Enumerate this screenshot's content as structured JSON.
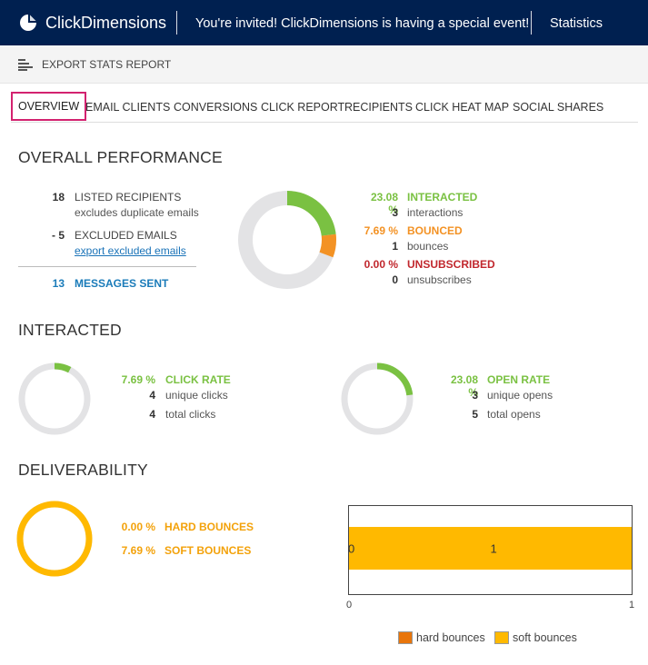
{
  "header": {
    "app_name": "ClickDimensions",
    "invite_text": "You're invited! ClickDimensions is having a special event!",
    "stats_link": "Statistics",
    "bg_color": "#002050"
  },
  "command_bar": {
    "export_label": "EXPORT STATS REPORT",
    "icon": "report-icon"
  },
  "tabs": [
    {
      "label": "OVERVIEW",
      "active": true
    },
    {
      "label": "EMAIL CLIENTS"
    },
    {
      "label": "CONVERSIONS"
    },
    {
      "label": "CLICK REPORT"
    },
    {
      "label": "RECIPIENTS"
    },
    {
      "label": "CLICK HEAT MAP"
    },
    {
      "label": "SOCIAL SHARES"
    }
  ],
  "overall": {
    "title": "OVERALL PERFORMANCE",
    "listed_num": "18",
    "listed_label": "LISTED RECIPIENTS",
    "listed_sub": "excludes duplicate emails",
    "excluded_num": "- 5",
    "excluded_label": "EXCLUDED EMAILS",
    "excluded_link": "export excluded emails",
    "sent_num": "13",
    "sent_label": "MESSAGES SENT",
    "donut": {
      "interacted_fraction": 0.2308,
      "bounced_fraction": 0.0769,
      "unsubscribed_fraction": 0.0
    },
    "interacted_pct": "23.08 %",
    "interacted_label": "INTERACTED",
    "interactions_num": "3",
    "interactions_sub": "interactions",
    "bounced_pct": "7.69 %",
    "bounced_label": "BOUNCED",
    "bounces_num": "1",
    "bounces_sub": "bounces",
    "unsub_pct": "0.00 %",
    "unsub_label": "UNSUBSCRIBED",
    "unsub_num": "0",
    "unsub_sub": "unsubscribes"
  },
  "interacted": {
    "title": "INTERACTED",
    "click_fraction": 0.0769,
    "click_pct": "7.69 %",
    "click_label": "CLICK RATE",
    "unique_clicks_num": "4",
    "unique_clicks_sub": "unique clicks",
    "total_clicks_num": "4",
    "total_clicks_sub": "total clicks",
    "open_fraction": 0.2308,
    "open_pct": "23.08 %",
    "open_label": "OPEN RATE",
    "unique_opens_num": "3",
    "unique_opens_sub": "unique opens",
    "total_opens_num": "5",
    "total_opens_sub": "total opens"
  },
  "deliverability": {
    "title": "DELIVERABILITY",
    "hard_pct": "0.00 %",
    "hard_label": "HARD BOUNCES",
    "soft_pct": "7.69 %",
    "soft_label": "SOFT BOUNCES",
    "donut_soft_fraction": 1.0
  },
  "chart_data": {
    "type": "bar",
    "orientation": "horizontal",
    "stacked": true,
    "series": [
      {
        "name": "hard bounces",
        "values": [
          0
        ],
        "color": "#e8750b"
      },
      {
        "name": "soft bounces",
        "values": [
          1
        ],
        "color": "#ffb900"
      }
    ],
    "data_labels": [
      "0",
      "1"
    ],
    "xlim": [
      0,
      1
    ],
    "x_ticks": [
      "0",
      "1"
    ],
    "grid": false,
    "legend_position": "bottom"
  },
  "colors": {
    "interacted": "#7ac142",
    "bounced": "#f39224",
    "unsubscribed": "#c1272d",
    "sent": "#1a7bb9",
    "soft": "#ffb900",
    "track": "#e3e3e5"
  }
}
